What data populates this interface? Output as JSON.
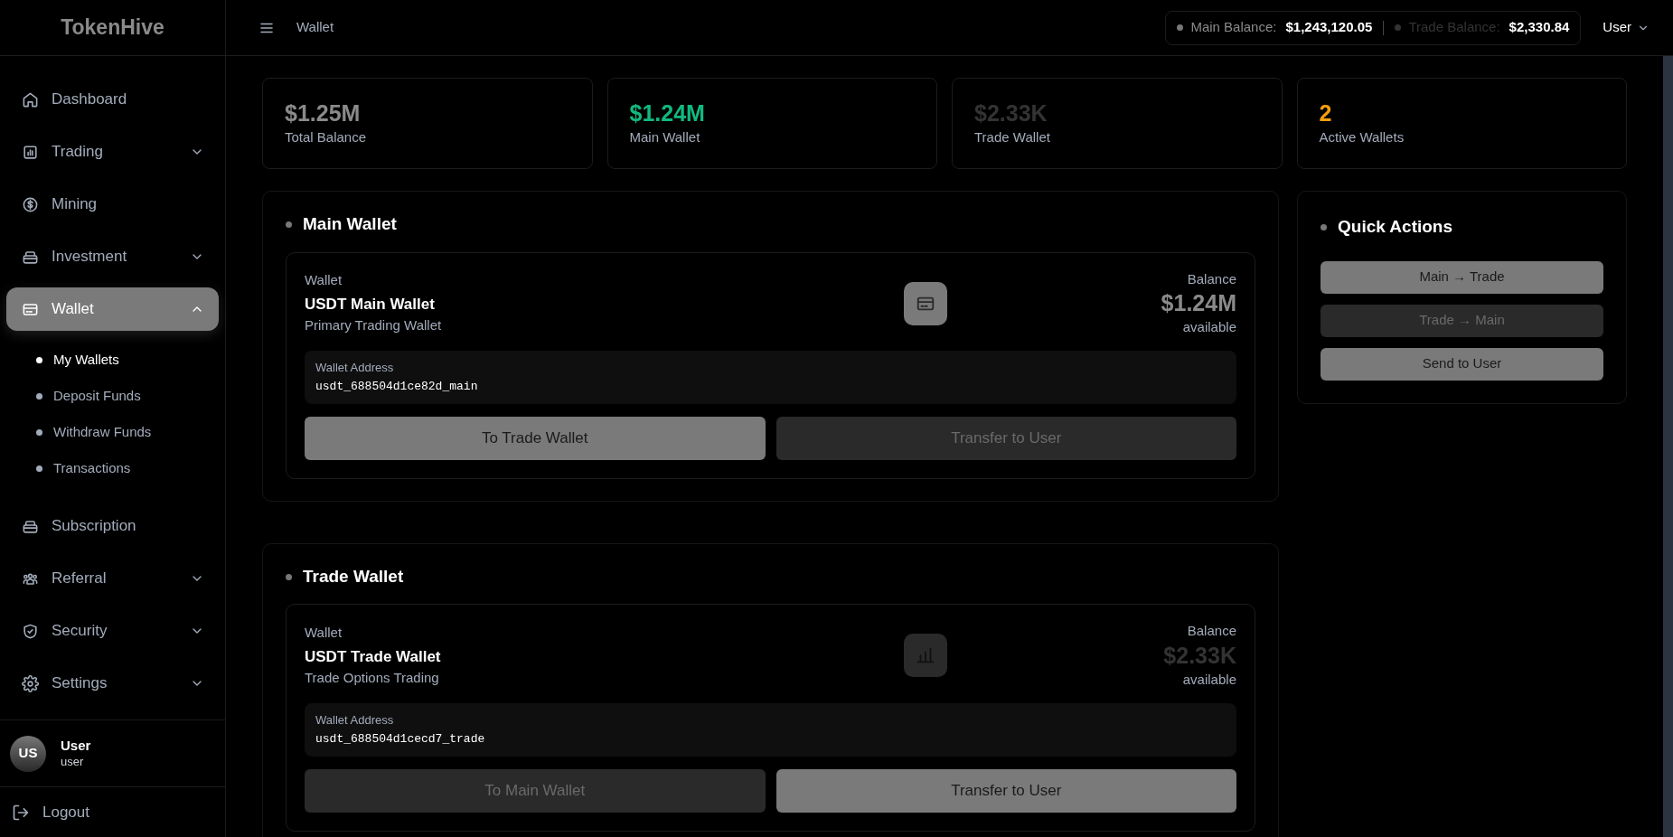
{
  "brand": "TokenHive",
  "sidebar": {
    "items": [
      {
        "label": "Dashboard",
        "kind": "link",
        "selected": false
      },
      {
        "label": "Trading",
        "kind": "group",
        "selected": false,
        "expanded": false
      },
      {
        "label": "Mining",
        "kind": "link",
        "selected": false
      },
      {
        "label": "Investment",
        "kind": "group",
        "selected": false,
        "expanded": false
      },
      {
        "label": "Wallet",
        "kind": "group",
        "selected": true,
        "expanded": true,
        "children": [
          {
            "label": "My Wallets",
            "selected": true
          },
          {
            "label": "Deposit Funds",
            "selected": false
          },
          {
            "label": "Withdraw Funds",
            "selected": false
          },
          {
            "label": "Transactions",
            "selected": false
          }
        ]
      },
      {
        "label": "Subscription",
        "kind": "link",
        "selected": false
      },
      {
        "label": "Referral",
        "kind": "group",
        "selected": false,
        "expanded": false
      },
      {
        "label": "Security",
        "kind": "group",
        "selected": false,
        "expanded": false
      },
      {
        "label": "Settings",
        "kind": "group",
        "selected": false,
        "expanded": false
      }
    ],
    "user": {
      "initials": "US",
      "name": "User",
      "role": "user"
    },
    "logout": "Logout"
  },
  "header": {
    "title": "Wallet",
    "balances": [
      {
        "label": "Main Balance:",
        "value": "$1,243,120.05",
        "active": true
      },
      {
        "label": "Trade Balance:",
        "value": "$2,330.84",
        "active": false
      }
    ],
    "user_menu": "User"
  },
  "stats": [
    {
      "value": "$1.25M",
      "label": "Total Balance",
      "color": "#8a8a8a"
    },
    {
      "value": "$1.24M",
      "label": "Main Wallet",
      "color": "#10b981"
    },
    {
      "value": "$2.33K",
      "label": "Trade Wallet",
      "color": "#333333"
    },
    {
      "value": "2",
      "label": "Active Wallets",
      "color": "#f59e0b"
    }
  ],
  "wallets": [
    {
      "title": "Main Wallet",
      "active": true,
      "caption": "Wallet",
      "name": "USDT Main Wallet",
      "description": "Primary Trading Wallet",
      "balance_label": "Balance",
      "balance": "$1.24M",
      "balance_note": "available",
      "address_label": "Wallet Address",
      "address": "usdt_688504d1ce82d_main",
      "buttons": [
        {
          "label": "To Trade Wallet",
          "kind": "primary"
        },
        {
          "label": "Transfer to User",
          "kind": "secondary"
        }
      ]
    },
    {
      "title": "Trade Wallet",
      "active": false,
      "caption": "Wallet",
      "name": "USDT Trade Wallet",
      "description": "Trade Options Trading",
      "balance_label": "Balance",
      "balance": "$2.33K",
      "balance_note": "available",
      "address_label": "Wallet Address",
      "address": "usdt_688504d1cecd7_trade",
      "buttons": [
        {
          "label": "To Main Wallet",
          "kind": "secondary"
        },
        {
          "label": "Transfer to User",
          "kind": "primary"
        }
      ]
    }
  ],
  "quick_actions": {
    "title": "Quick Actions",
    "buttons": [
      {
        "label": "Main → Trade",
        "kind": "primary"
      },
      {
        "label": "Trade → Main",
        "kind": "secondary"
      },
      {
        "label": "Send to User",
        "kind": "primary"
      }
    ]
  }
}
